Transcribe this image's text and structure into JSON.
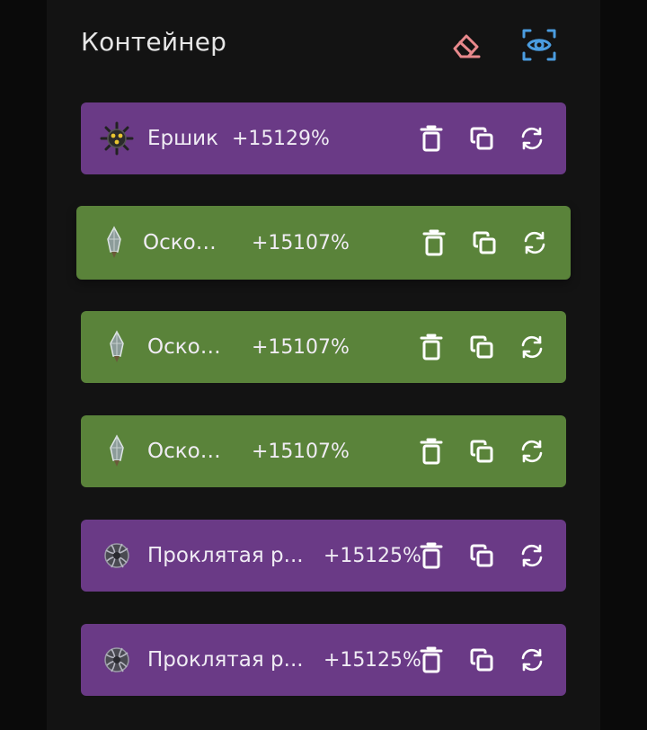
{
  "header": {
    "title": "Контейнер",
    "clear_icon": "eraser-icon",
    "view_icon": "eye-scan-icon"
  },
  "colors": {
    "purple": "#6a3a86",
    "green": "#5a833a",
    "eraser": "#e8898c",
    "eye": "#4b9de0"
  },
  "items": [
    {
      "name": "Ершик",
      "level": "+15",
      "percent": "129%",
      "color": "purple",
      "icon": "spiked-ball-icon"
    },
    {
      "name": "Осколок",
      "level": "+15",
      "percent": "107%",
      "color": "green",
      "icon": "crystal-shard-icon"
    },
    {
      "name": "Осколок",
      "level": "+15",
      "percent": "107%",
      "color": "green",
      "icon": "crystal-shard-icon"
    },
    {
      "name": "Осколок",
      "level": "+15",
      "percent": "107%",
      "color": "green",
      "icon": "crystal-shard-icon"
    },
    {
      "name": "Проклятая р...",
      "level": "+15",
      "percent": "125%",
      "color": "purple",
      "icon": "cursed-orb-icon"
    },
    {
      "name": "Проклятая р...",
      "level": "+15",
      "percent": "125%",
      "color": "purple",
      "icon": "cursed-orb-icon"
    }
  ]
}
